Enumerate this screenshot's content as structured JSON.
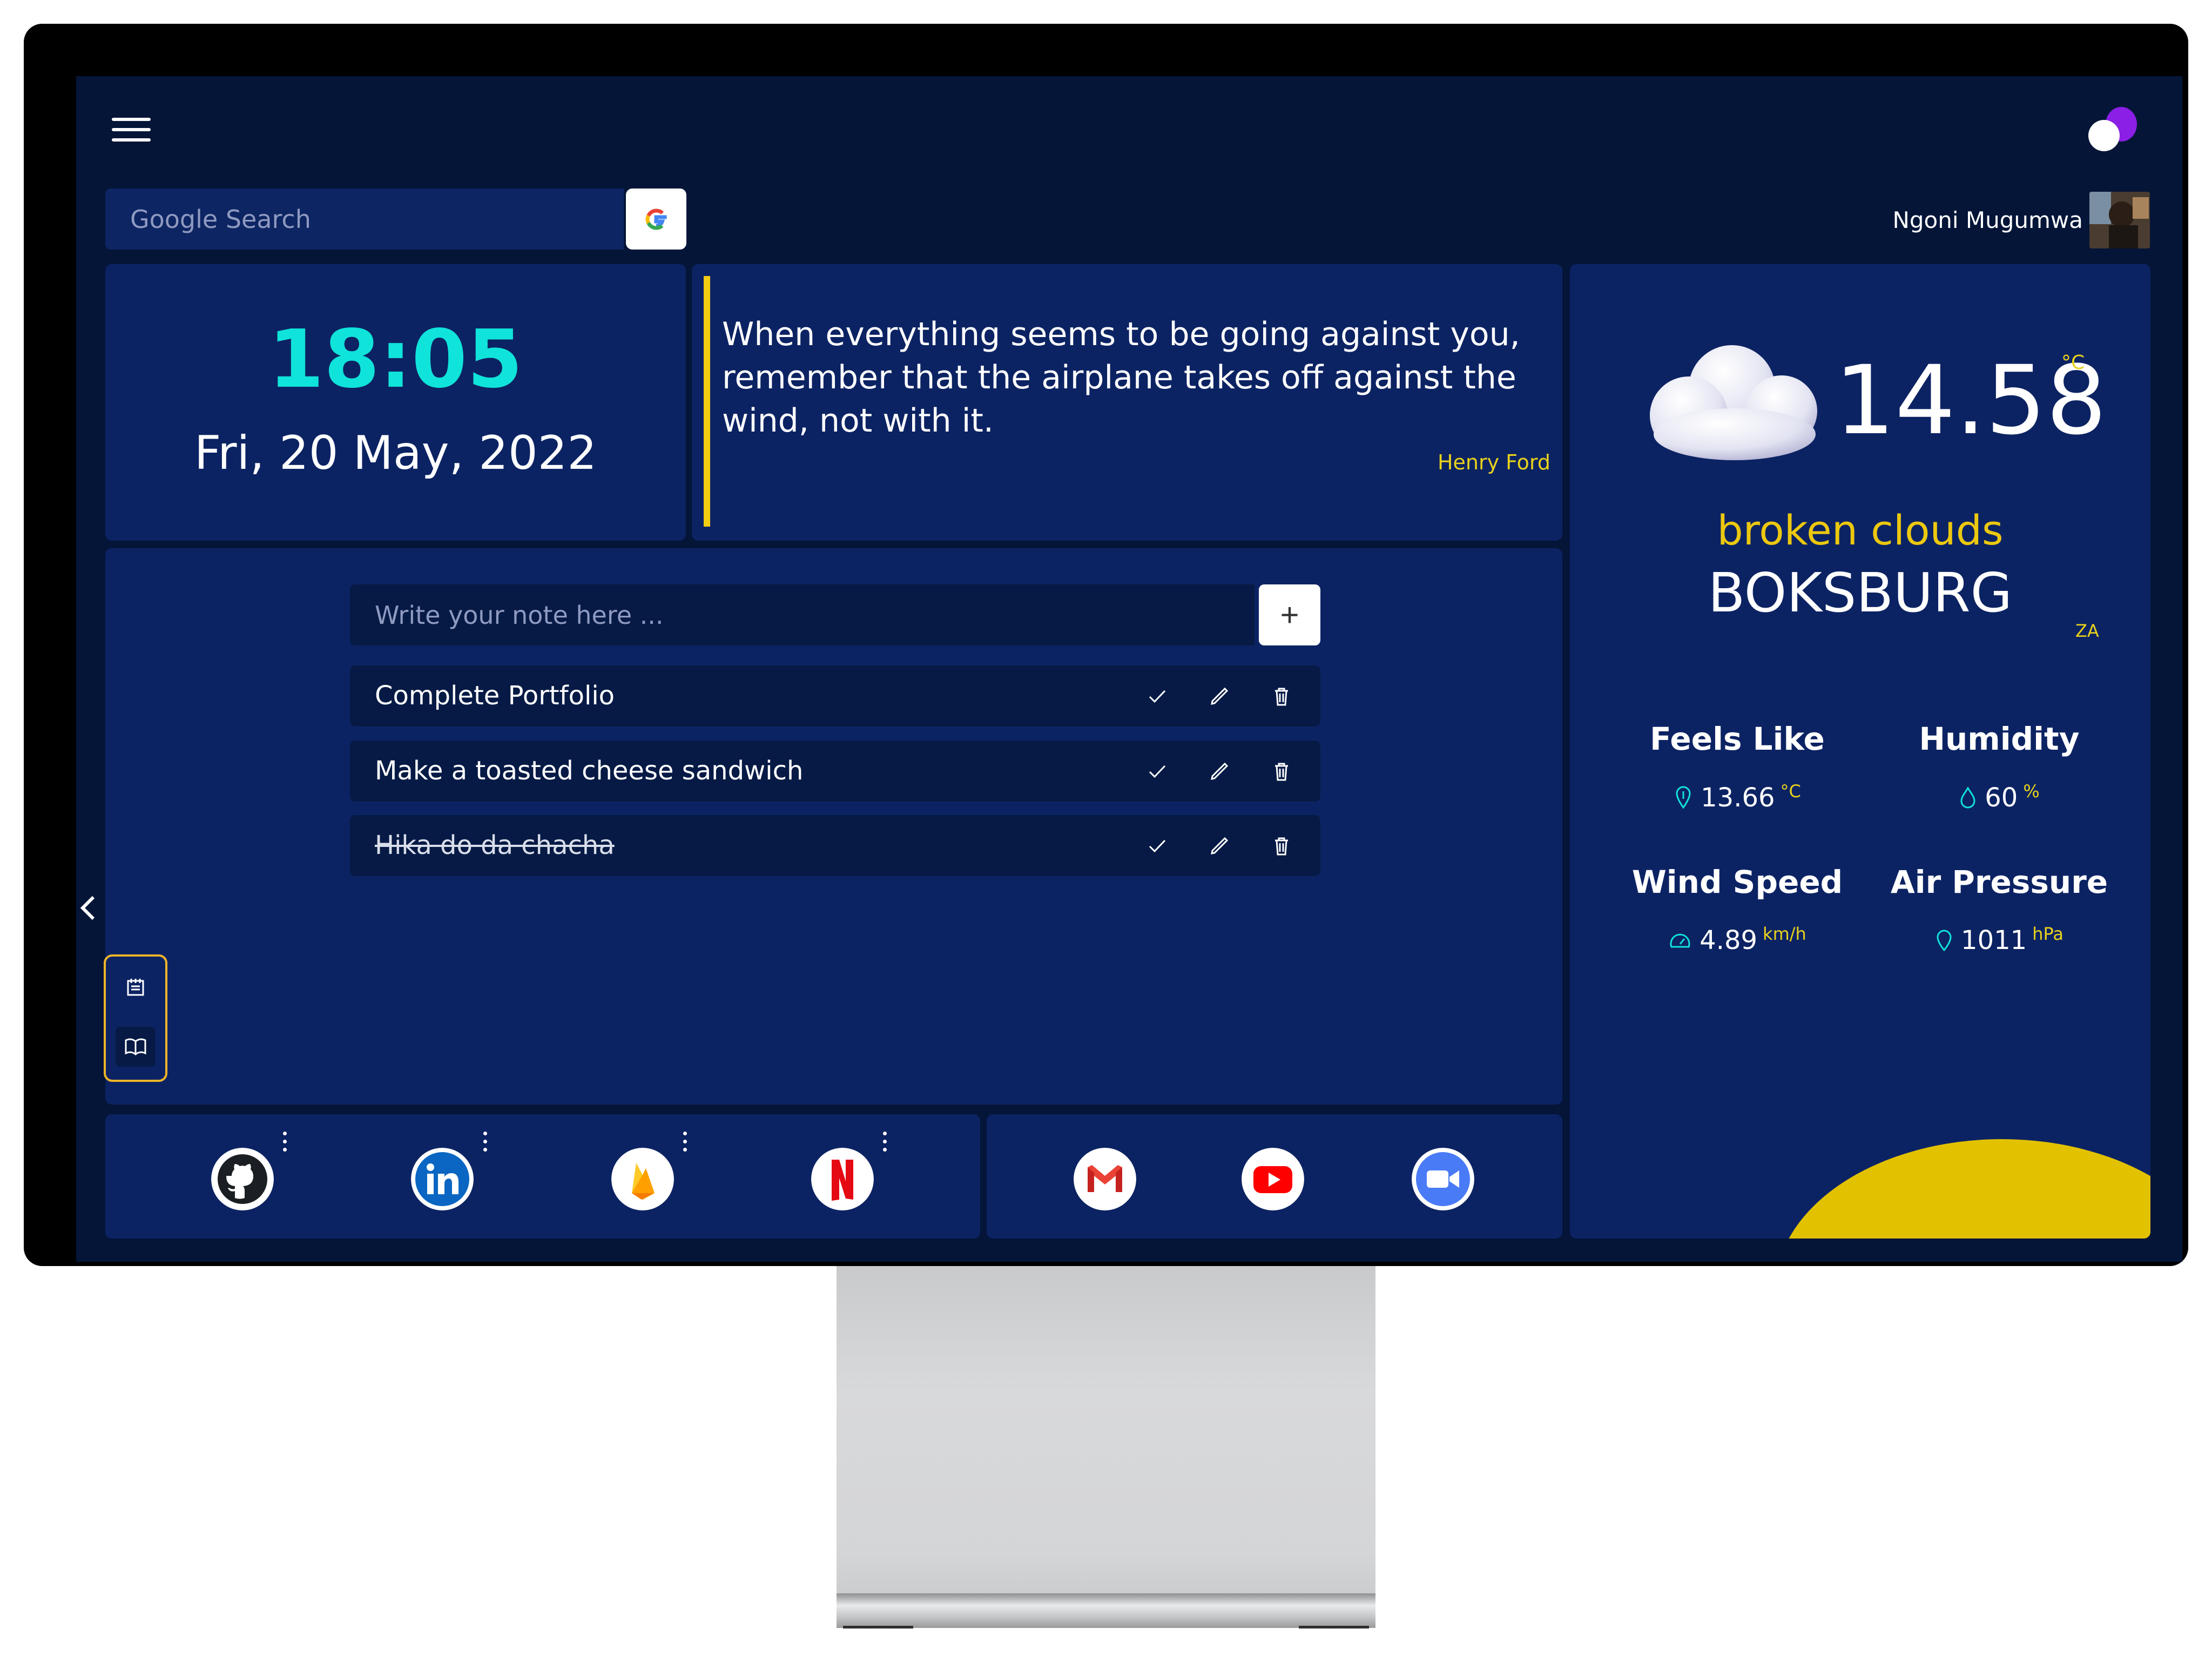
{
  "header": {
    "search_placeholder": "Google Search",
    "user_name": "Ngoni Mugumwa"
  },
  "clock": {
    "time": "18:05",
    "date": "Fri, 20 May, 2022"
  },
  "quote": {
    "text": "When everything seems to be going against you, remember that the airplane takes off against the wind, not with it.",
    "author": "Henry Ford"
  },
  "notes": {
    "input_placeholder": "Write your note here ...",
    "add_label": "+",
    "items": [
      {
        "text": "Complete Portfolio",
        "done": false
      },
      {
        "text": "Make a toasted cheese sandwich",
        "done": false
      },
      {
        "text": "Hika do da chacha",
        "done": true
      }
    ]
  },
  "quick_links": [
    "github-icon",
    "linkedin-icon",
    "firebase-icon",
    "netflix-icon"
  ],
  "apps": [
    "gmail-icon",
    "youtube-icon",
    "zoom-icon"
  ],
  "weather": {
    "temperature": "14.58",
    "temperature_unit": "°C",
    "description": "broken clouds",
    "city": "BOKSBURG",
    "country": "ZA",
    "feels_like_label": "Feels Like",
    "feels_like_value": "13.66",
    "feels_like_unit": "°C",
    "humidity_label": "Humidity",
    "humidity_value": "60",
    "humidity_unit": "%",
    "wind_label": "Wind Speed",
    "wind_value": "4.89",
    "wind_unit": "km/h",
    "pressure_label": "Air Pressure",
    "pressure_value": "1011",
    "pressure_unit": "hPa"
  },
  "colors": {
    "background": "#041538",
    "panel": "#0c2363",
    "accent_cyan": "#10e3da",
    "accent_yellow": "#e8d21c"
  }
}
